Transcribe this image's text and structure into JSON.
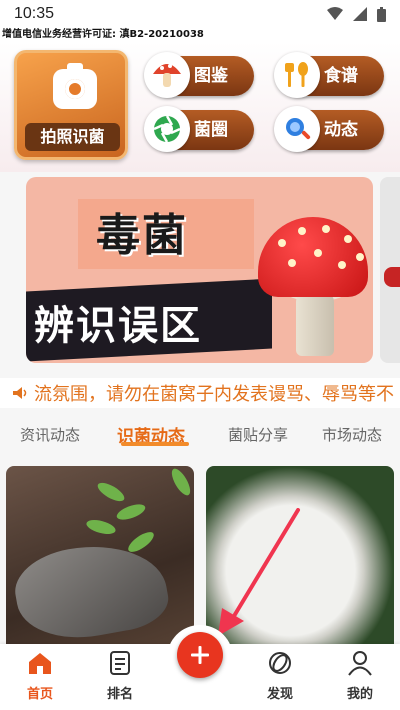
{
  "status_bar": {
    "time": "10:35"
  },
  "license": "增值电信业务经营许可证: 滇B2-20210038",
  "quick_actions": {
    "camera_label": "拍照识菌",
    "items": [
      {
        "label": "图鉴",
        "icon": "mushroom-icon"
      },
      {
        "label": "食谱",
        "icon": "utensils-icon"
      },
      {
        "label": "菌圈",
        "icon": "aperture-icon"
      },
      {
        "label": "动态",
        "icon": "magnifier-icon"
      }
    ]
  },
  "banner": {
    "line1": "毒菌",
    "line2": "辨识误区"
  },
  "notice": {
    "text": "流氛围，请勿在菌窝子内发表谩骂、辱骂等不"
  },
  "tabs": [
    {
      "label": "资讯动态"
    },
    {
      "label": "识菌动态",
      "active": true
    },
    {
      "label": "菌贴分享"
    },
    {
      "label": "市场动态"
    }
  ],
  "bottom_nav": {
    "items": [
      {
        "label": "首页",
        "active": true
      },
      {
        "label": "排名"
      },
      {
        "label": "发现"
      },
      {
        "label": "我的"
      }
    ]
  },
  "colors": {
    "accent": "#e8551c",
    "fab": "#e8351f",
    "pill": "#8a4216"
  }
}
